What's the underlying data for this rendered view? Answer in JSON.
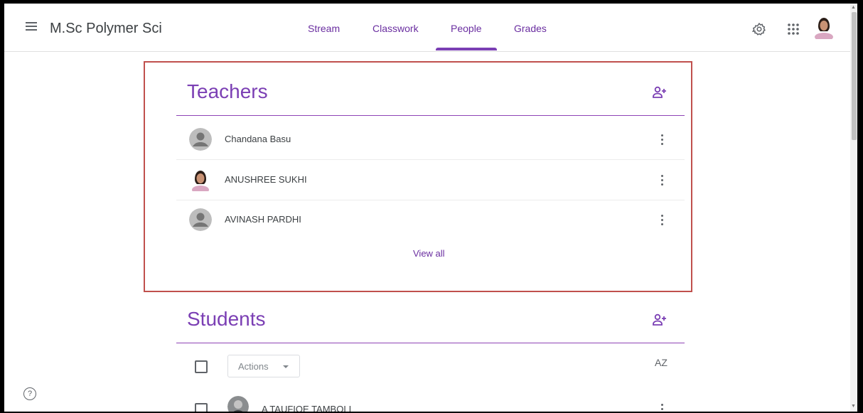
{
  "header": {
    "class_title": "M.Sc Polymer Sci",
    "tabs": [
      {
        "label": "Stream"
      },
      {
        "label": "Classwork"
      },
      {
        "label": "People",
        "active": true
      },
      {
        "label": "Grades"
      }
    ],
    "icons": [
      "menu-icon",
      "settings-icon",
      "apps-icon",
      "account-avatar"
    ]
  },
  "teachers": {
    "title": "Teachers",
    "list": [
      {
        "name": "Chandana Basu",
        "avatar": "default"
      },
      {
        "name": "ANUSHREE SUKHI",
        "avatar": "photo"
      },
      {
        "name": "AVINASH PARDHI",
        "avatar": "default"
      }
    ],
    "view_all": "View all"
  },
  "students": {
    "title": "Students",
    "actions_label": "Actions",
    "sort_label": "AZ",
    "list": [
      {
        "name": "A TAUFIQE TAMBOLI",
        "avatar": "photo"
      }
    ]
  },
  "help_label": "?",
  "colors": {
    "accent": "#7b3fb4",
    "highlight_border": "#c0504d"
  }
}
